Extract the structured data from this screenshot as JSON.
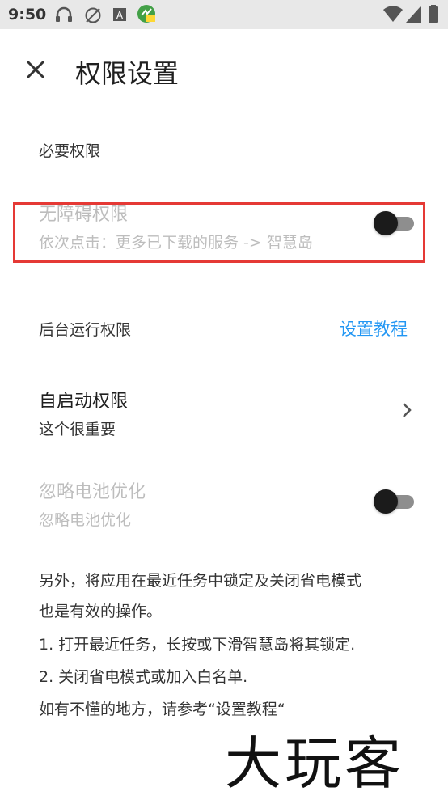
{
  "status_bar": {
    "time": "9:50",
    "left_icons": [
      "headphones-icon",
      "no-sync-icon",
      "text-a-icon",
      "app-badge-icon"
    ],
    "right_icons": [
      "wifi-icon",
      "signal-icon",
      "battery-icon"
    ]
  },
  "app_bar": {
    "title": "权限设置",
    "close_icon": "close-icon"
  },
  "sections": {
    "required": {
      "header": "必要权限",
      "accessibility": {
        "title": "无障碍权限",
        "summary": "依次点击：更多已下载的服务 -> 智慧岛",
        "enabled": false
      }
    },
    "background": {
      "header": "后台运行权限",
      "tutorial_link": "设置教程",
      "autostart": {
        "title": "自启动权限",
        "summary": "这个很重要"
      },
      "battery": {
        "title": "忽略电池优化",
        "summary": "忽略电池优化",
        "enabled": false
      }
    }
  },
  "notes": {
    "line1": "另外，将应用在最近任务中锁定及关闭省电模式",
    "line2": "也是有效的操作。",
    "line3": "1. 打开最近任务，长按或下滑智慧岛将其锁定.",
    "line4": "2. 关闭省电模式或加入白名单.",
    "line5": "如有不懂的地方，请参考“设置教程“"
  },
  "watermark": "大玩客",
  "colors": {
    "accent": "#2196f3",
    "highlight": "#e53935",
    "disabled_text": "#bdbdbd"
  }
}
